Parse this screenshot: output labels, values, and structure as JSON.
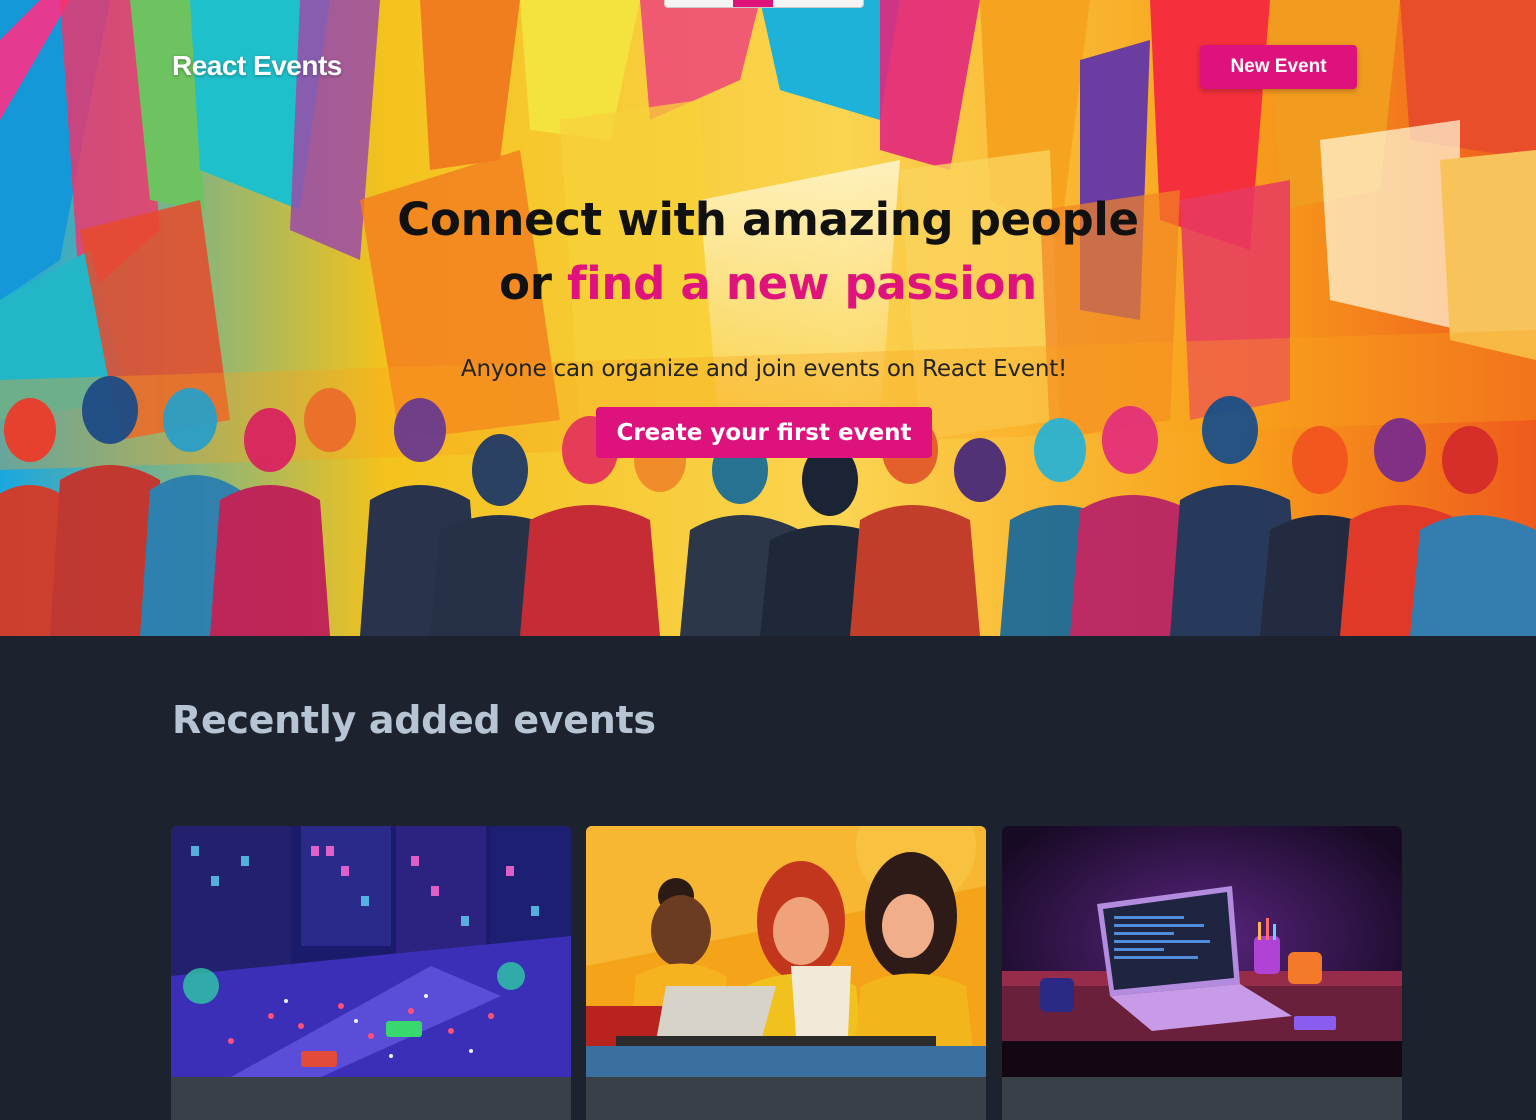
{
  "app": {
    "brand": "React Events",
    "new_event_label": "New Event"
  },
  "hero": {
    "headline_line1": "Connect with amazing people",
    "headline_line2_prefix": "or",
    "headline_line2_accent": "find a new passion",
    "subtitle": "Anyone can organize and join events on React Event!",
    "cta_label": "Create your first event",
    "image_icon": "crowd-illustration"
  },
  "recent": {
    "title": "Recently added events",
    "cards": [
      {
        "image_icon": "night-city-illustration"
      },
      {
        "image_icon": "women-laptops-illustration"
      },
      {
        "image_icon": "laptop-desk-illustration"
      }
    ]
  },
  "colors": {
    "accent": "#de127c",
    "page_bg": "#1c232e",
    "card_footer": "#3a4048",
    "section_title": "#b6c4d4"
  }
}
